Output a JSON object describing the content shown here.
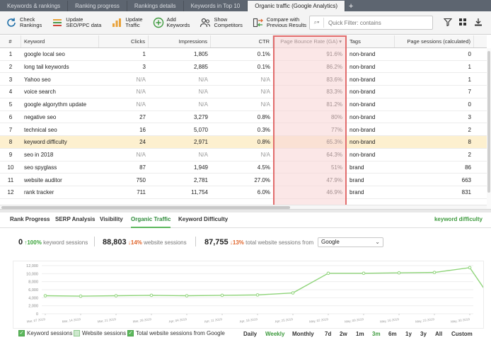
{
  "tabs": [
    {
      "label": "Keywords & rankings",
      "active": false
    },
    {
      "label": "Ranking progress",
      "active": false
    },
    {
      "label": "Rankings details",
      "active": false
    },
    {
      "label": "Keywords in Top 10",
      "active": false
    },
    {
      "label": "Organic traffic (Google Analytics)",
      "active": true
    }
  ],
  "tab_add": "+",
  "toolbar": {
    "check_rankings": "Check\nRankings",
    "update_seo": "Update\nSEO/PPC data",
    "update_traffic": "Update\nTraffic",
    "add_keywords": "Add\nKeywords",
    "show_competitors": "Show\nCompetitors",
    "compare": "Compare with\nPrevious Results",
    "filter_placeholder": "Quick Filter: contains"
  },
  "table": {
    "headers": {
      "num": "#",
      "keyword": "Keyword",
      "clicks": "Clicks",
      "impressions": "Impressions",
      "ctr": "CTR",
      "bounce": "Page Bounce Rate (GA)",
      "sort_indicator": "▾",
      "tags": "Tags",
      "sessions": "Page sessions (calculated)"
    },
    "rows": [
      {
        "num": "1",
        "keyword": "google local seo",
        "clicks": "1",
        "impressions": "1,805",
        "ctr": "0.1%",
        "bounce": "91.6%",
        "tags": "non-brand",
        "sessions": "0"
      },
      {
        "num": "2",
        "keyword": "long tail keywords",
        "clicks": "3",
        "impressions": "2,885",
        "ctr": "0.1%",
        "bounce": "86.2%",
        "tags": "non-brand",
        "sessions": "1"
      },
      {
        "num": "3",
        "keyword": "Yahoo seo",
        "clicks": "N/A",
        "impressions": "N/A",
        "ctr": "N/A",
        "bounce": "83.6%",
        "tags": "non-brand",
        "sessions": "1"
      },
      {
        "num": "4",
        "keyword": "voice search",
        "clicks": "N/A",
        "impressions": "N/A",
        "ctr": "N/A",
        "bounce": "83.3%",
        "tags": "non-brand",
        "sessions": "7"
      },
      {
        "num": "5",
        "keyword": "google algorythm update",
        "clicks": "N/A",
        "impressions": "N/A",
        "ctr": "N/A",
        "bounce": "81.2%",
        "tags": "non-brand",
        "sessions": "0"
      },
      {
        "num": "6",
        "keyword": "negative seo",
        "clicks": "27",
        "impressions": "3,279",
        "ctr": "0.8%",
        "bounce": "80%",
        "tags": "non-brand",
        "sessions": "3"
      },
      {
        "num": "7",
        "keyword": "technical seo",
        "clicks": "16",
        "impressions": "5,070",
        "ctr": "0.3%",
        "bounce": "77%",
        "tags": "non-brand",
        "sessions": "2"
      },
      {
        "num": "8",
        "keyword": "keyword difficulty",
        "clicks": "24",
        "impressions": "2,971",
        "ctr": "0.8%",
        "bounce": "65.3%",
        "tags": "non-brand",
        "sessions": "8"
      },
      {
        "num": "9",
        "keyword": "seo in 2018",
        "clicks": "N/A",
        "impressions": "N/A",
        "ctr": "N/A",
        "bounce": "64.3%",
        "tags": "non-brand",
        "sessions": "2"
      },
      {
        "num": "10",
        "keyword": "seo spyglass",
        "clicks": "87",
        "impressions": "1,949",
        "ctr": "4.5%",
        "bounce": "51%",
        "tags": "brand",
        "sessions": "86"
      },
      {
        "num": "11",
        "keyword": "website auditor",
        "clicks": "750",
        "impressions": "2,781",
        "ctr": "27.0%",
        "bounce": "47.9%",
        "tags": "brand",
        "sessions": "663"
      },
      {
        "num": "12",
        "keyword": "rank tracker",
        "clicks": "711",
        "impressions": "11,754",
        "ctr": "6.0%",
        "bounce": "46.9%",
        "tags": "brand",
        "sessions": "831"
      }
    ],
    "selected_row": 7
  },
  "bottom_tabs": [
    {
      "label": "Rank Progress",
      "active": false
    },
    {
      "label": "SERP Analysis",
      "active": false
    },
    {
      "label": "Visibility",
      "active": false
    },
    {
      "label": "Organic Traffic",
      "active": true
    },
    {
      "label": "Keyword Difficulty",
      "active": false
    }
  ],
  "selected_keyword": "keyword difficulty",
  "stats": {
    "keyword_sessions": {
      "value": "0",
      "change": "100%",
      "label": "keyword sessions"
    },
    "website_sessions": {
      "value": "88,803",
      "change": "14%",
      "label": "website sessions"
    },
    "total_sessions": {
      "value": "87,755",
      "change": "13%",
      "label": "total website sessions from"
    },
    "source": "Google"
  },
  "chart_data": {
    "type": "line",
    "y_ticks": [
      "12,000",
      "10,000",
      "8,000",
      "6,000",
      "4,000",
      "2,000",
      "0"
    ],
    "ylim": [
      0,
      12000
    ],
    "x_ticks": [
      "Mar, 07 2019",
      "Mar, 14 2019",
      "Mar, 21 2019",
      "Mar, 28 2019",
      "Apr, 04 2019",
      "Apr, 11 2019",
      "Apr, 18 2019",
      "Apr, 25 2019",
      "May, 02 2019",
      "May, 09 2019",
      "May, 16 2019",
      "May, 23 2019",
      "May, 30 2019"
    ],
    "series": [
      {
        "name": "Total website sessions from Google",
        "color": "#8fd47a",
        "x": [
          "Mar, 07 2019",
          "Mar, 14 2019",
          "Mar, 21 2019",
          "Mar, 28 2019",
          "Apr, 04 2019",
          "Apr, 11 2019",
          "Apr, 18 2019",
          "Apr, 25 2019",
          "May, 02 2019",
          "May, 09 2019",
          "May, 16 2019",
          "May, 23 2019",
          "May, 30 2019",
          "Jun, 03 2019"
        ],
        "values": [
          4500,
          4400,
          4500,
          4600,
          4500,
          4600,
          4700,
          5200,
          10100,
          10100,
          10200,
          10300,
          11500,
          4400
        ]
      }
    ],
    "legend": [
      {
        "label": "Keyword sessions",
        "checked": true
      },
      {
        "label": "Website sessions",
        "checked": false
      },
      {
        "label": "Total website sessions from Google",
        "checked": true
      }
    ]
  },
  "ranges": {
    "granularity": [
      "Daily",
      "Weekly",
      "Monthly"
    ],
    "active_granularity": "Weekly",
    "periods": [
      "7d",
      "2w",
      "1m",
      "3m",
      "6m",
      "1y",
      "3y",
      "All",
      "Custom"
    ],
    "active_period": "3m"
  },
  "colors": {
    "accent": "#5cb85c",
    "highlight_border": "#e16c6c",
    "selected_row": "#fdf0cf"
  }
}
